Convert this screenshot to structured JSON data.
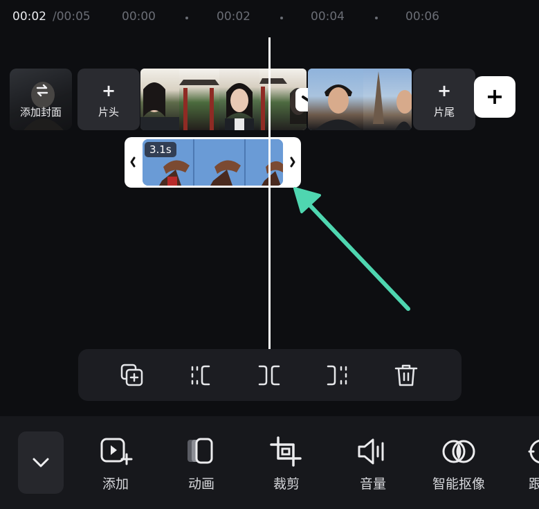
{
  "timeline": {
    "current": "00:02",
    "total": "/00:05",
    "ticks": [
      "00:00",
      "00:02",
      "00:04",
      "00:06"
    ]
  },
  "track": {
    "cover_label": "添加封面",
    "intro_label": "片头",
    "outro_label": "片尾",
    "plus": "+",
    "add_clip_plus": "+"
  },
  "overlay_clip": {
    "duration": "3.1s"
  },
  "toolbar": {
    "icons": [
      "copy-add-icon",
      "split-left-icon",
      "split-icon",
      "split-right-icon",
      "trash-icon"
    ]
  },
  "bottom_tabs": [
    {
      "label": "添加",
      "icon": "video-add-icon"
    },
    {
      "label": "动画",
      "icon": "animation-icon"
    },
    {
      "label": "裁剪",
      "icon": "crop-icon"
    },
    {
      "label": "音量",
      "icon": "volume-icon"
    },
    {
      "label": "智能抠像",
      "icon": "smart-cutout-icon"
    },
    {
      "label": "跟",
      "icon": "track-icon"
    }
  ],
  "colors": {
    "background": "#0d0e11",
    "accent_arrow": "#4fd6b0",
    "tile": "#2a2b30",
    "panel": "#1c1d22"
  }
}
